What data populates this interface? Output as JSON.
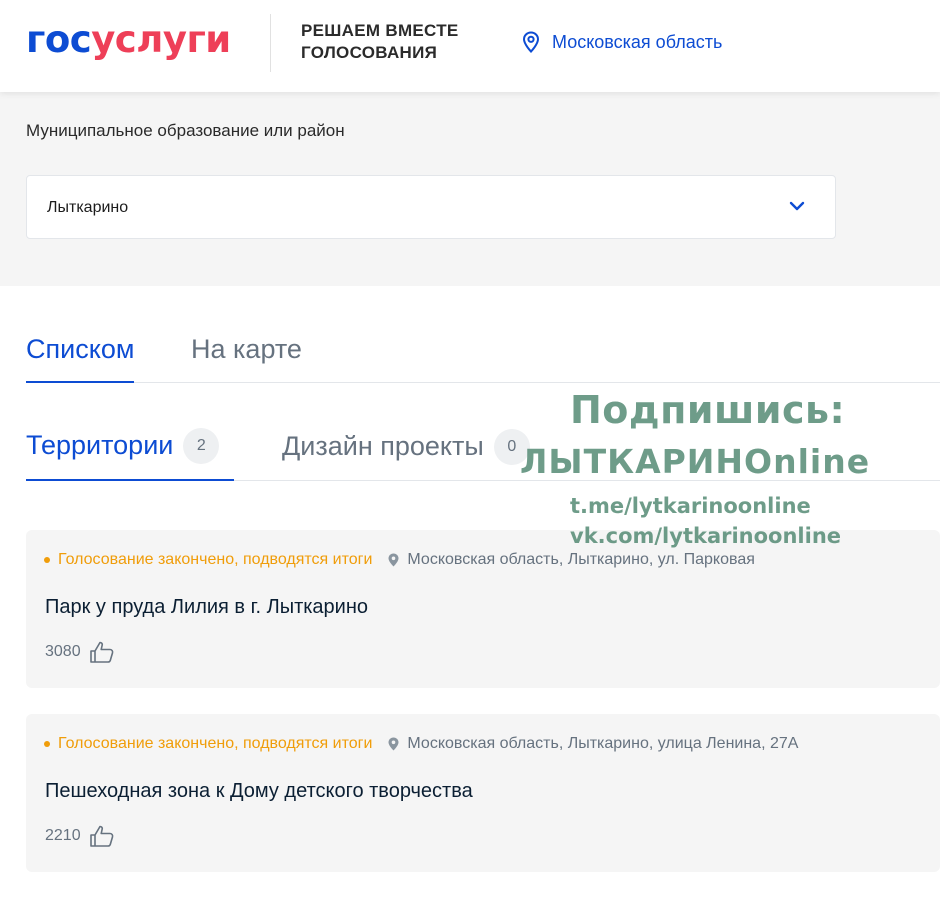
{
  "header": {
    "logo_part1": "гос",
    "logo_part2": "услуги",
    "tagline_line1": "РЕШАЕМ ВМЕСТЕ",
    "tagline_line2": "ГОЛОСОВАНИЯ",
    "region": "Московская область",
    "region_icon": "location-pin-icon"
  },
  "filter": {
    "label": "Муниципальное образование или район",
    "selected": "Лыткарино"
  },
  "view_tabs": [
    {
      "label": "Списком",
      "active": true
    },
    {
      "label": "На карте",
      "active": false
    }
  ],
  "category_tabs": [
    {
      "label": "Территории",
      "count": "2",
      "active": true
    },
    {
      "label": "Дизайн проекты",
      "count": "0",
      "active": false
    }
  ],
  "watermark": {
    "title": "Подпишись:",
    "brand": "ЛЫТКАРИНОnline",
    "link1": "t.me/lytkarinoonline",
    "link2": "vk.com/lytkarinoonline"
  },
  "projects": [
    {
      "status": "Голосование закончено, подводятся итоги",
      "address": "Московская область, Лыткарино, ул. Парковая",
      "title": "Парк у пруда Лилия в г. Лыткарино",
      "votes": "3080"
    },
    {
      "status": "Голосование закончено, подводятся итоги",
      "address": "Московская область, Лыткарино, улица Ленина, 27А",
      "title": "Пешеходная зона к Дому детского творчества",
      "votes": "2210"
    }
  ],
  "colors": {
    "brand_blue": "#0d4cd3",
    "brand_red": "#ee3f58",
    "status_orange": "#f09d0a",
    "muted_text": "#66727f",
    "watermark_green": "#4e866f"
  }
}
